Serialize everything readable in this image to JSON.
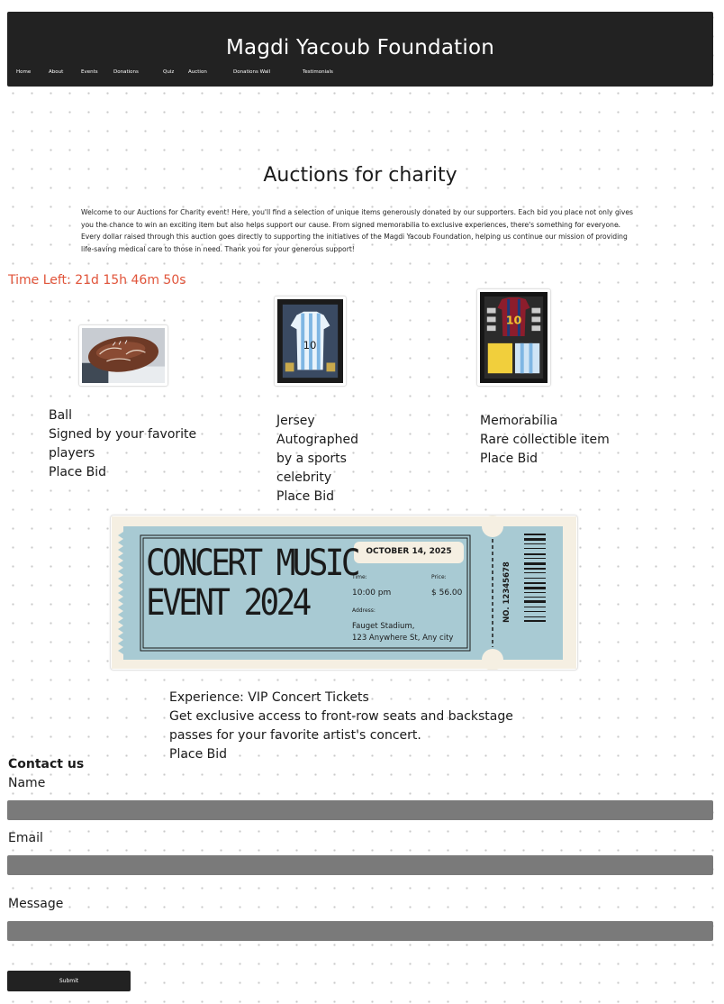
{
  "header": {
    "title": "Magdi Yacoub Foundation",
    "nav": [
      "Home",
      "About",
      "Events",
      "Donations",
      "Quiz",
      "Auction",
      "Donations Wall",
      "Testimonials"
    ]
  },
  "page": {
    "title": "Auctions for charity",
    "intro": "Welcome to our Auctions for Charity event! Here, you'll find a selection of unique items generously donated by our supporters. Each bid you place not only gives you the chance to win an exciting item but also helps support our cause. From signed memorabilia to exclusive experiences, there's something for everyone. Every dollar raised through this auction goes directly to supporting the initiatives of the Magdi Yacoub Foundation, helping us continue our mission of providing life-saving medical care to those in need. Thank you for your generous support!",
    "timer": "Time Left: 21d 15h 46m 50s"
  },
  "items": [
    {
      "name": "Ball",
      "lines": [
        "Signed by your favorite",
        "players"
      ],
      "bid": "Place Bid",
      "image": "signed-football"
    },
    {
      "name": "Jersey",
      "lines": [
        "Autographed",
        "by a sports",
        "celebrity"
      ],
      "bid": "Place Bid",
      "image": "framed-jersey"
    },
    {
      "name": "Memorabilia",
      "lines": [
        "Rare collectible item"
      ],
      "bid": "Place Bid",
      "image": "framed-memorabilia"
    }
  ],
  "ticket": {
    "headline1": "CONCERT MUSIC",
    "headline2": "EVENT 2024",
    "date": "OCTOBER 14, 2025",
    "time_label": "Time:",
    "time": "10:00 pm",
    "price_label": "Price:",
    "price": "$ 56.00",
    "address_label": "Address:",
    "address1": "Fauget Stadium,",
    "address2": "123 Anywhere St, Any city",
    "number": "NO. 12345678",
    "colors": {
      "ticket": "#a8cad3",
      "frame": "#f5efe2",
      "ink": "#1a1a1a"
    }
  },
  "experience": {
    "title": "Experience: VIP Concert Tickets",
    "line1": "Get exclusive access to front-row seats and backstage",
    "line2": "passes for your favorite artist's concert.",
    "bid": "Place Bid"
  },
  "contact": {
    "title": "Contact us",
    "name_label": "Name",
    "email_label": "Email",
    "message_label": "Message",
    "submit": "Submit"
  },
  "colors": {
    "header": "#222222",
    "timer": "#e1543a",
    "field": "#7a7a7a"
  }
}
